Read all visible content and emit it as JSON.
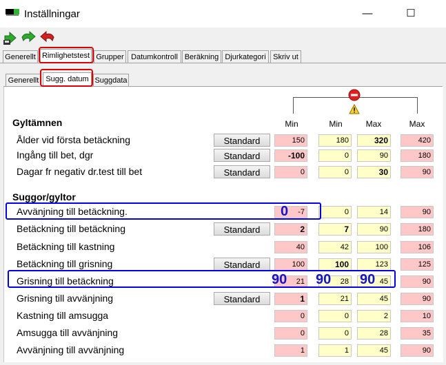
{
  "window": {
    "title": "Inställningar",
    "minimize": "—",
    "maximize": "☐"
  },
  "toolbar": {
    "icons": [
      "save-arrow-icon",
      "forward-arrow-icon",
      "undo-arrow-icon"
    ]
  },
  "main_tabs": [
    "Generellt",
    "Rimlighetstest",
    "Grupper",
    "Datumkontroll",
    "Beräkning",
    "Djurkategori",
    "Skriv ut"
  ],
  "sub_tabs": [
    "Generellt",
    "Sugg. datum",
    "Suggdata"
  ],
  "columns": {
    "min1": "Min",
    "min2": "Min",
    "max1": "Max",
    "max2": "Max"
  },
  "std_label": "Standard",
  "overlay_numbers": {
    "avvanjning": "0",
    "grisning_a": "90",
    "grisning_b": "90",
    "grisning_c": "90"
  },
  "sections": [
    {
      "title": "Gyltämnen",
      "rows": [
        {
          "label": "Ålder vid första betäckning",
          "std": true,
          "v": [
            "150",
            "180",
            "320",
            "420"
          ],
          "b": [
            false,
            false,
            true,
            false
          ]
        },
        {
          "label": "Ingång till bet, dgr",
          "std": true,
          "v": [
            "-100",
            "0",
            "90",
            "180"
          ],
          "b": [
            true,
            false,
            false,
            false
          ]
        },
        {
          "label": "Dagar fr negativ dr.test till bet",
          "std": true,
          "v": [
            "0",
            "0",
            "30",
            "90"
          ],
          "b": [
            false,
            false,
            true,
            false
          ]
        }
      ]
    },
    {
      "title": "Suggor/gyltor",
      "rows": [
        {
          "label": "Avvänjning till betäckning.",
          "std": false,
          "v": [
            "-7",
            "0",
            "14",
            "90"
          ],
          "b": [
            false,
            false,
            false,
            false
          ]
        },
        {
          "label": "Betäckning till betäckning",
          "std": true,
          "v": [
            "2",
            "7",
            "90",
            "180"
          ],
          "b": [
            true,
            true,
            false,
            false
          ]
        },
        {
          "label": "Betäckning till kastning",
          "std": false,
          "v": [
            "40",
            "42",
            "100",
            "106"
          ],
          "b": [
            false,
            false,
            false,
            false
          ]
        },
        {
          "label": "Betäckning till grisning",
          "std": true,
          "v": [
            "100",
            "100",
            "123",
            "125"
          ],
          "b": [
            false,
            true,
            false,
            false
          ]
        },
        {
          "label": "Grisning till betäckning",
          "std": false,
          "v": [
            "21",
            "28",
            "45",
            "90"
          ],
          "b": [
            false,
            false,
            false,
            false
          ]
        },
        {
          "label": "Grisning till avvänjning",
          "std": true,
          "v": [
            "1",
            "21",
            "45",
            "90"
          ],
          "b": [
            true,
            false,
            false,
            false
          ]
        },
        {
          "label": "Kastning till amsugga",
          "std": false,
          "v": [
            "0",
            "0",
            "2",
            "10"
          ],
          "b": [
            false,
            false,
            false,
            false
          ]
        },
        {
          "label": "Amsugga till avvänjning",
          "std": false,
          "v": [
            "0",
            "0",
            "28",
            "35"
          ],
          "b": [
            false,
            false,
            false,
            false
          ]
        },
        {
          "label": "Avvänjning till avvänjning",
          "std": false,
          "v": [
            "1",
            "1",
            "45",
            "90"
          ],
          "b": [
            false,
            false,
            false,
            false
          ]
        }
      ]
    }
  ]
}
